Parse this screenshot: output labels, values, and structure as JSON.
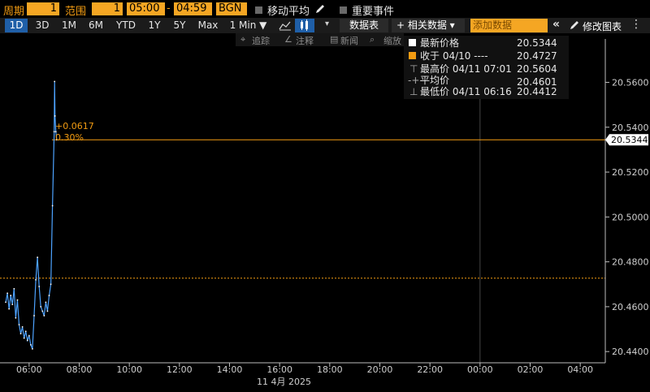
{
  "toolbar": {
    "period_label": "周期",
    "period_value": "1",
    "range_label": "范围",
    "range_value": "1",
    "time_start": "05:00",
    "time_sep": "-",
    "time_end": "04:59",
    "source": "BGN",
    "moving_avg_label": "移动平均",
    "events_label": "重要事件"
  },
  "ranges": [
    "1D",
    "3D",
    "1M",
    "6M",
    "YTD",
    "1Y",
    "5Y",
    "Max"
  ],
  "active_range": "1D",
  "interval": "1 Min ▼",
  "buttons": {
    "data_table": "数据表",
    "related_data": "+ 相关数据 ▾",
    "add_data_placeholder": "添加数据",
    "edit_chart": "修改图表"
  },
  "subtools": {
    "track": "追踪",
    "annotate": "注释",
    "news": "新闻",
    "zoom": "缩放"
  },
  "legend": {
    "rows": [
      {
        "label": "最新价格",
        "value": "20.5344",
        "color": "#ffffff"
      },
      {
        "label": "收于 04/10 ----",
        "value": "20.4727",
        "color": "#f39c12"
      },
      {
        "label": "最高价 04/11 07:01",
        "value": "20.5604",
        "color": "#aaaaaa"
      },
      {
        "label": "平均价",
        "value": "20.4601",
        "color": "#aaaaaa"
      },
      {
        "label": "最低价 04/11 06:16",
        "value": "20.4412",
        "color": "#aaaaaa"
      }
    ]
  },
  "annotation": {
    "change": "+0.0617",
    "pct": "0.30%"
  },
  "colors": {
    "accent": "#f39c12",
    "line": "#4da3ff",
    "active": "#1f5fa8"
  },
  "chart_data": {
    "type": "line",
    "xlabel": "11 4月 2025",
    "ylabel": "",
    "ylim": [
      20.435,
      20.575
    ],
    "xlim": [
      "05:00",
      "04:59"
    ],
    "yticks": [
      "20.4400",
      "20.4600",
      "20.4800",
      "20.5000",
      "20.5200",
      "20.5400",
      "20.5600"
    ],
    "xticks": [
      "06:00",
      "08:00",
      "10:00",
      "12:00",
      "14:00",
      "16:00",
      "18:00",
      "20:00",
      "22:00",
      "00:00",
      "02:00",
      "04:00"
    ],
    "last_price": 20.5344,
    "prev_close": 20.4727,
    "high": 20.5604,
    "low": 20.4412,
    "series": [
      {
        "x": [
          "05:04",
          "05:08",
          "05:12",
          "05:16",
          "05:20",
          "05:24",
          "05:28",
          "05:32",
          "05:36",
          "05:40",
          "05:44",
          "05:48",
          "05:52",
          "05:56",
          "06:00",
          "06:04",
          "06:08",
          "06:12",
          "06:16",
          "06:20",
          "06:24",
          "06:28",
          "06:32",
          "06:36",
          "06:40",
          "06:44",
          "06:48",
          "06:52",
          "06:56",
          "07:00",
          "07:01",
          "07:02",
          "07:04",
          "07:06"
        ],
        "values": [
          20.462,
          20.466,
          20.459,
          20.465,
          20.461,
          20.468,
          20.455,
          20.463,
          20.452,
          20.448,
          20.451,
          20.446,
          20.449,
          20.445,
          20.447,
          20.443,
          20.4412,
          20.456,
          20.472,
          20.482,
          20.469,
          20.46,
          20.458,
          20.456,
          20.462,
          20.458,
          20.465,
          20.47,
          20.505,
          20.538,
          20.5604,
          20.545,
          20.538,
          20.5344
        ]
      }
    ]
  }
}
